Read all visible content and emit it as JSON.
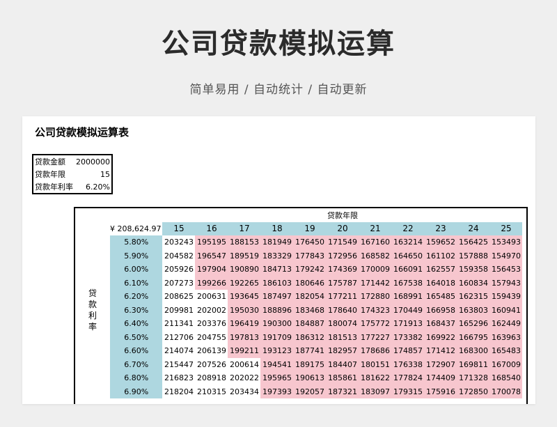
{
  "hero": {
    "title": "公司贷款模拟运算",
    "subtitle": "简单易用 / 自动统计 / 自动更新"
  },
  "sheet": {
    "title": "公司贷款模拟运算表",
    "params": [
      {
        "label": "贷款金额",
        "value": "2000000"
      },
      {
        "label": "贷款年限",
        "value": "15"
      },
      {
        "label": "贷款年利率",
        "value": "6.20%"
      }
    ],
    "grid": {
      "header_label": "贷款年限",
      "side_label": [
        "贷",
        "款",
        "利",
        "率"
      ],
      "corner": "¥ 208,624.97",
      "years": [
        "15",
        "16",
        "17",
        "18",
        "19",
        "20",
        "21",
        "22",
        "23",
        "24",
        "25"
      ],
      "rows": [
        {
          "rate": "5.80%",
          "values": [
            "203243",
            "195195",
            "188153",
            "181949",
            "176450",
            "171549",
            "167160",
            "163214",
            "159652",
            "156425",
            "153493"
          ]
        },
        {
          "rate": "5.90%",
          "values": [
            "204582",
            "196547",
            "189519",
            "183329",
            "177843",
            "172956",
            "168582",
            "164650",
            "161102",
            "157888",
            "154970"
          ]
        },
        {
          "rate": "6.00%",
          "values": [
            "205926",
            "197904",
            "190890",
            "184713",
            "179242",
            "174369",
            "170009",
            "166091",
            "162557",
            "159358",
            "156453"
          ]
        },
        {
          "rate": "6.10%",
          "values": [
            "207273",
            "199266",
            "192265",
            "186103",
            "180646",
            "175787",
            "171442",
            "167538",
            "164018",
            "160834",
            "157943"
          ]
        },
        {
          "rate": "6.20%",
          "values": [
            "208625",
            "200631",
            "193645",
            "187497",
            "182054",
            "177211",
            "172880",
            "168991",
            "165485",
            "162315",
            "159439"
          ]
        },
        {
          "rate": "6.30%",
          "values": [
            "209981",
            "202002",
            "195030",
            "188896",
            "183468",
            "178640",
            "174323",
            "170449",
            "166958",
            "163803",
            "160941"
          ]
        },
        {
          "rate": "6.40%",
          "values": [
            "211341",
            "203376",
            "196419",
            "190300",
            "184887",
            "180074",
            "175772",
            "171913",
            "168437",
            "165296",
            "162449"
          ]
        },
        {
          "rate": "6.50%",
          "values": [
            "212706",
            "204755",
            "197813",
            "191709",
            "186312",
            "181513",
            "177227",
            "173382",
            "169922",
            "166795",
            "163963"
          ]
        },
        {
          "rate": "6.60%",
          "values": [
            "214074",
            "206139",
            "199211",
            "193123",
            "187741",
            "182957",
            "178686",
            "174857",
            "171412",
            "168300",
            "165483"
          ]
        },
        {
          "rate": "6.70%",
          "values": [
            "215447",
            "207526",
            "200614",
            "194541",
            "189175",
            "184407",
            "180151",
            "176338",
            "172907",
            "169811",
            "167009"
          ]
        },
        {
          "rate": "6.80%",
          "values": [
            "216823",
            "208918",
            "202022",
            "195965",
            "190613",
            "185861",
            "181622",
            "177824",
            "174409",
            "171328",
            "168540"
          ]
        },
        {
          "rate": "6.90%",
          "values": [
            "218204",
            "210315",
            "203434",
            "197393",
            "192057",
            "187321",
            "183097",
            "179315",
            "175916",
            "172850",
            "170078"
          ]
        }
      ],
      "white_cells_per_row": [
        1,
        1,
        1,
        1,
        2,
        2,
        2,
        2,
        2,
        3,
        3,
        3
      ],
      "colors": {
        "header_blue": "#aed7e0",
        "highlight_pink": "#f7c6ce"
      }
    }
  }
}
